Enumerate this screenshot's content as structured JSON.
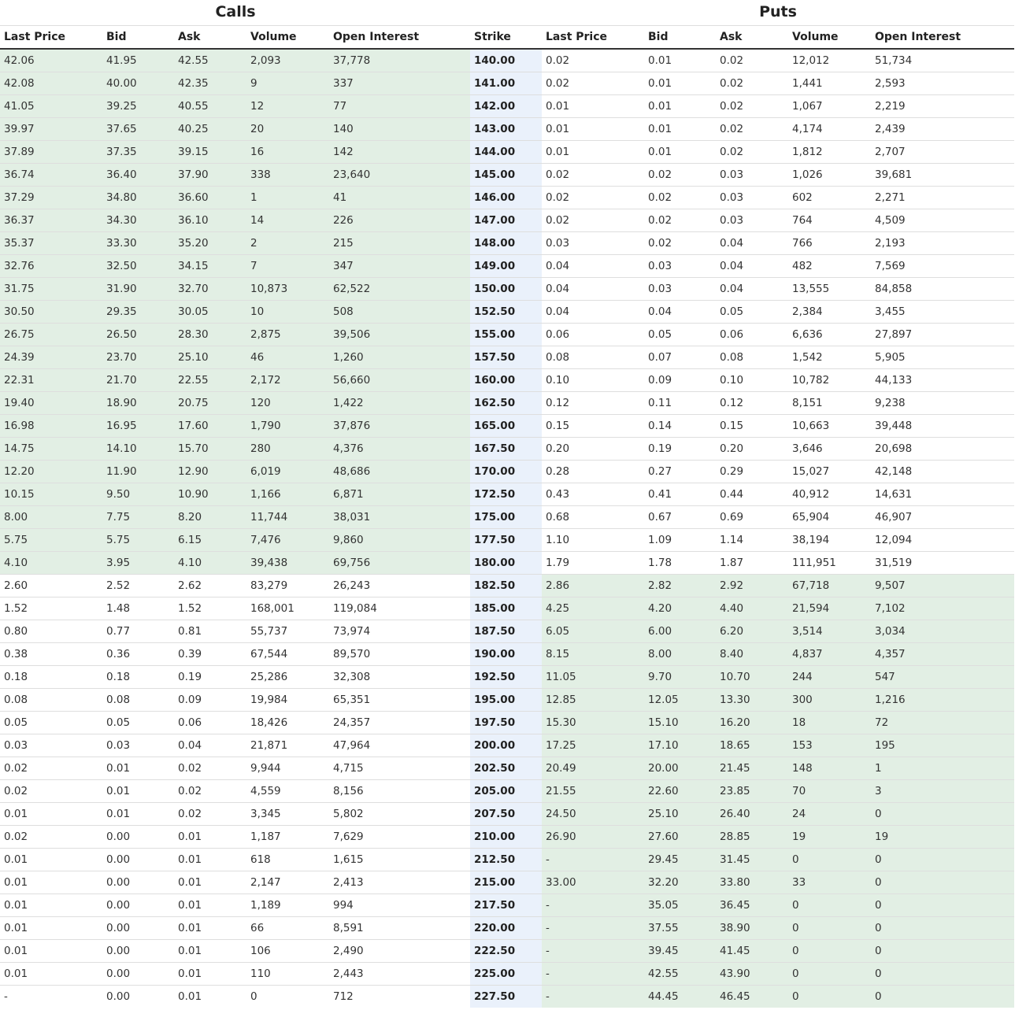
{
  "headers": {
    "calls_title": "Calls",
    "puts_title": "Puts",
    "columns": [
      "Last Price",
      "Bid",
      "Ask",
      "Volume",
      "Open Interest",
      "Strike",
      "Last Price",
      "Bid",
      "Ask",
      "Volume",
      "Open Interest"
    ]
  },
  "colors": {
    "in_the_money": "#e2efe4",
    "strike_column": "#eaf1fb",
    "row_divider": "#dedede",
    "header_divider": "#333333"
  },
  "rows": [
    {
      "calls": [
        "42.06",
        "41.95",
        "42.55",
        "2,093",
        "37,778"
      ],
      "strike": "140.00",
      "puts": [
        "0.02",
        "0.01",
        "0.02",
        "12,012",
        "51,734"
      ],
      "calls_itm": true,
      "puts_itm": false
    },
    {
      "calls": [
        "42.08",
        "40.00",
        "42.35",
        "9",
        "337"
      ],
      "strike": "141.00",
      "puts": [
        "0.02",
        "0.01",
        "0.02",
        "1,441",
        "2,593"
      ],
      "calls_itm": true,
      "puts_itm": false
    },
    {
      "calls": [
        "41.05",
        "39.25",
        "40.55",
        "12",
        "77"
      ],
      "strike": "142.00",
      "puts": [
        "0.01",
        "0.01",
        "0.02",
        "1,067",
        "2,219"
      ],
      "calls_itm": true,
      "puts_itm": false
    },
    {
      "calls": [
        "39.97",
        "37.65",
        "40.25",
        "20",
        "140"
      ],
      "strike": "143.00",
      "puts": [
        "0.01",
        "0.01",
        "0.02",
        "4,174",
        "2,439"
      ],
      "calls_itm": true,
      "puts_itm": false
    },
    {
      "calls": [
        "37.89",
        "37.35",
        "39.15",
        "16",
        "142"
      ],
      "strike": "144.00",
      "puts": [
        "0.01",
        "0.01",
        "0.02",
        "1,812",
        "2,707"
      ],
      "calls_itm": true,
      "puts_itm": false
    },
    {
      "calls": [
        "36.74",
        "36.40",
        "37.90",
        "338",
        "23,640"
      ],
      "strike": "145.00",
      "puts": [
        "0.02",
        "0.02",
        "0.03",
        "1,026",
        "39,681"
      ],
      "calls_itm": true,
      "puts_itm": false
    },
    {
      "calls": [
        "37.29",
        "34.80",
        "36.60",
        "1",
        "41"
      ],
      "strike": "146.00",
      "puts": [
        "0.02",
        "0.02",
        "0.03",
        "602",
        "2,271"
      ],
      "calls_itm": true,
      "puts_itm": false
    },
    {
      "calls": [
        "36.37",
        "34.30",
        "36.10",
        "14",
        "226"
      ],
      "strike": "147.00",
      "puts": [
        "0.02",
        "0.02",
        "0.03",
        "764",
        "4,509"
      ],
      "calls_itm": true,
      "puts_itm": false
    },
    {
      "calls": [
        "35.37",
        "33.30",
        "35.20",
        "2",
        "215"
      ],
      "strike": "148.00",
      "puts": [
        "0.03",
        "0.02",
        "0.04",
        "766",
        "2,193"
      ],
      "calls_itm": true,
      "puts_itm": false
    },
    {
      "calls": [
        "32.76",
        "32.50",
        "34.15",
        "7",
        "347"
      ],
      "strike": "149.00",
      "puts": [
        "0.04",
        "0.03",
        "0.04",
        "482",
        "7,569"
      ],
      "calls_itm": true,
      "puts_itm": false
    },
    {
      "calls": [
        "31.75",
        "31.90",
        "32.70",
        "10,873",
        "62,522"
      ],
      "strike": "150.00",
      "puts": [
        "0.04",
        "0.03",
        "0.04",
        "13,555",
        "84,858"
      ],
      "calls_itm": true,
      "puts_itm": false
    },
    {
      "calls": [
        "30.50",
        "29.35",
        "30.05",
        "10",
        "508"
      ],
      "strike": "152.50",
      "puts": [
        "0.04",
        "0.04",
        "0.05",
        "2,384",
        "3,455"
      ],
      "calls_itm": true,
      "puts_itm": false
    },
    {
      "calls": [
        "26.75",
        "26.50",
        "28.30",
        "2,875",
        "39,506"
      ],
      "strike": "155.00",
      "puts": [
        "0.06",
        "0.05",
        "0.06",
        "6,636",
        "27,897"
      ],
      "calls_itm": true,
      "puts_itm": false
    },
    {
      "calls": [
        "24.39",
        "23.70",
        "25.10",
        "46",
        "1,260"
      ],
      "strike": "157.50",
      "puts": [
        "0.08",
        "0.07",
        "0.08",
        "1,542",
        "5,905"
      ],
      "calls_itm": true,
      "puts_itm": false
    },
    {
      "calls": [
        "22.31",
        "21.70",
        "22.55",
        "2,172",
        "56,660"
      ],
      "strike": "160.00",
      "puts": [
        "0.10",
        "0.09",
        "0.10",
        "10,782",
        "44,133"
      ],
      "calls_itm": true,
      "puts_itm": false
    },
    {
      "calls": [
        "19.40",
        "18.90",
        "20.75",
        "120",
        "1,422"
      ],
      "strike": "162.50",
      "puts": [
        "0.12",
        "0.11",
        "0.12",
        "8,151",
        "9,238"
      ],
      "calls_itm": true,
      "puts_itm": false
    },
    {
      "calls": [
        "16.98",
        "16.95",
        "17.60",
        "1,790",
        "37,876"
      ],
      "strike": "165.00",
      "puts": [
        "0.15",
        "0.14",
        "0.15",
        "10,663",
        "39,448"
      ],
      "calls_itm": true,
      "puts_itm": false
    },
    {
      "calls": [
        "14.75",
        "14.10",
        "15.70",
        "280",
        "4,376"
      ],
      "strike": "167.50",
      "puts": [
        "0.20",
        "0.19",
        "0.20",
        "3,646",
        "20,698"
      ],
      "calls_itm": true,
      "puts_itm": false
    },
    {
      "calls": [
        "12.20",
        "11.90",
        "12.90",
        "6,019",
        "48,686"
      ],
      "strike": "170.00",
      "puts": [
        "0.28",
        "0.27",
        "0.29",
        "15,027",
        "42,148"
      ],
      "calls_itm": true,
      "puts_itm": false
    },
    {
      "calls": [
        "10.15",
        "9.50",
        "10.90",
        "1,166",
        "6,871"
      ],
      "strike": "172.50",
      "puts": [
        "0.43",
        "0.41",
        "0.44",
        "40,912",
        "14,631"
      ],
      "calls_itm": true,
      "puts_itm": false
    },
    {
      "calls": [
        "8.00",
        "7.75",
        "8.20",
        "11,744",
        "38,031"
      ],
      "strike": "175.00",
      "puts": [
        "0.68",
        "0.67",
        "0.69",
        "65,904",
        "46,907"
      ],
      "calls_itm": true,
      "puts_itm": false
    },
    {
      "calls": [
        "5.75",
        "5.75",
        "6.15",
        "7,476",
        "9,860"
      ],
      "strike": "177.50",
      "puts": [
        "1.10",
        "1.09",
        "1.14",
        "38,194",
        "12,094"
      ],
      "calls_itm": true,
      "puts_itm": false
    },
    {
      "calls": [
        "4.10",
        "3.95",
        "4.10",
        "39,438",
        "69,756"
      ],
      "strike": "180.00",
      "puts": [
        "1.79",
        "1.78",
        "1.87",
        "111,951",
        "31,519"
      ],
      "calls_itm": true,
      "puts_itm": false
    },
    {
      "calls": [
        "2.60",
        "2.52",
        "2.62",
        "83,279",
        "26,243"
      ],
      "strike": "182.50",
      "puts": [
        "2.86",
        "2.82",
        "2.92",
        "67,718",
        "9,507"
      ],
      "calls_itm": false,
      "puts_itm": true
    },
    {
      "calls": [
        "1.52",
        "1.48",
        "1.52",
        "168,001",
        "119,084"
      ],
      "strike": "185.00",
      "puts": [
        "4.25",
        "4.20",
        "4.40",
        "21,594",
        "7,102"
      ],
      "calls_itm": false,
      "puts_itm": true
    },
    {
      "calls": [
        "0.80",
        "0.77",
        "0.81",
        "55,737",
        "73,974"
      ],
      "strike": "187.50",
      "puts": [
        "6.05",
        "6.00",
        "6.20",
        "3,514",
        "3,034"
      ],
      "calls_itm": false,
      "puts_itm": true
    },
    {
      "calls": [
        "0.38",
        "0.36",
        "0.39",
        "67,544",
        "89,570"
      ],
      "strike": "190.00",
      "puts": [
        "8.15",
        "8.00",
        "8.40",
        "4,837",
        "4,357"
      ],
      "calls_itm": false,
      "puts_itm": true
    },
    {
      "calls": [
        "0.18",
        "0.18",
        "0.19",
        "25,286",
        "32,308"
      ],
      "strike": "192.50",
      "puts": [
        "11.05",
        "9.70",
        "10.70",
        "244",
        "547"
      ],
      "calls_itm": false,
      "puts_itm": true
    },
    {
      "calls": [
        "0.08",
        "0.08",
        "0.09",
        "19,984",
        "65,351"
      ],
      "strike": "195.00",
      "puts": [
        "12.85",
        "12.05",
        "13.30",
        "300",
        "1,216"
      ],
      "calls_itm": false,
      "puts_itm": true
    },
    {
      "calls": [
        "0.05",
        "0.05",
        "0.06",
        "18,426",
        "24,357"
      ],
      "strike": "197.50",
      "puts": [
        "15.30",
        "15.10",
        "16.20",
        "18",
        "72"
      ],
      "calls_itm": false,
      "puts_itm": true
    },
    {
      "calls": [
        "0.03",
        "0.03",
        "0.04",
        "21,871",
        "47,964"
      ],
      "strike": "200.00",
      "puts": [
        "17.25",
        "17.10",
        "18.65",
        "153",
        "195"
      ],
      "calls_itm": false,
      "puts_itm": true
    },
    {
      "calls": [
        "0.02",
        "0.01",
        "0.02",
        "9,944",
        "4,715"
      ],
      "strike": "202.50",
      "puts": [
        "20.49",
        "20.00",
        "21.45",
        "148",
        "1"
      ],
      "calls_itm": false,
      "puts_itm": true
    },
    {
      "calls": [
        "0.02",
        "0.01",
        "0.02",
        "4,559",
        "8,156"
      ],
      "strike": "205.00",
      "puts": [
        "21.55",
        "22.60",
        "23.85",
        "70",
        "3"
      ],
      "calls_itm": false,
      "puts_itm": true
    },
    {
      "calls": [
        "0.01",
        "0.01",
        "0.02",
        "3,345",
        "5,802"
      ],
      "strike": "207.50",
      "puts": [
        "24.50",
        "25.10",
        "26.40",
        "24",
        "0"
      ],
      "calls_itm": false,
      "puts_itm": true
    },
    {
      "calls": [
        "0.02",
        "0.00",
        "0.01",
        "1,187",
        "7,629"
      ],
      "strike": "210.00",
      "puts": [
        "26.90",
        "27.60",
        "28.85",
        "19",
        "19"
      ],
      "calls_itm": false,
      "puts_itm": true
    },
    {
      "calls": [
        "0.01",
        "0.00",
        "0.01",
        "618",
        "1,615"
      ],
      "strike": "212.50",
      "puts": [
        "-",
        "29.45",
        "31.45",
        "0",
        "0"
      ],
      "calls_itm": false,
      "puts_itm": true
    },
    {
      "calls": [
        "0.01",
        "0.00",
        "0.01",
        "2,147",
        "2,413"
      ],
      "strike": "215.00",
      "puts": [
        "33.00",
        "32.20",
        "33.80",
        "33",
        "0"
      ],
      "calls_itm": false,
      "puts_itm": true
    },
    {
      "calls": [
        "0.01",
        "0.00",
        "0.01",
        "1,189",
        "994"
      ],
      "strike": "217.50",
      "puts": [
        "-",
        "35.05",
        "36.45",
        "0",
        "0"
      ],
      "calls_itm": false,
      "puts_itm": true
    },
    {
      "calls": [
        "0.01",
        "0.00",
        "0.01",
        "66",
        "8,591"
      ],
      "strike": "220.00",
      "puts": [
        "-",
        "37.55",
        "38.90",
        "0",
        "0"
      ],
      "calls_itm": false,
      "puts_itm": true
    },
    {
      "calls": [
        "0.01",
        "0.00",
        "0.01",
        "106",
        "2,490"
      ],
      "strike": "222.50",
      "puts": [
        "-",
        "39.45",
        "41.45",
        "0",
        "0"
      ],
      "calls_itm": false,
      "puts_itm": true
    },
    {
      "calls": [
        "0.01",
        "0.00",
        "0.01",
        "110",
        "2,443"
      ],
      "strike": "225.00",
      "puts": [
        "-",
        "42.55",
        "43.90",
        "0",
        "0"
      ],
      "calls_itm": false,
      "puts_itm": true
    },
    {
      "calls": [
        "-",
        "0.00",
        "0.01",
        "0",
        "712"
      ],
      "strike": "227.50",
      "puts": [
        "-",
        "44.45",
        "46.45",
        "0",
        "0"
      ],
      "calls_itm": false,
      "puts_itm": true
    }
  ]
}
